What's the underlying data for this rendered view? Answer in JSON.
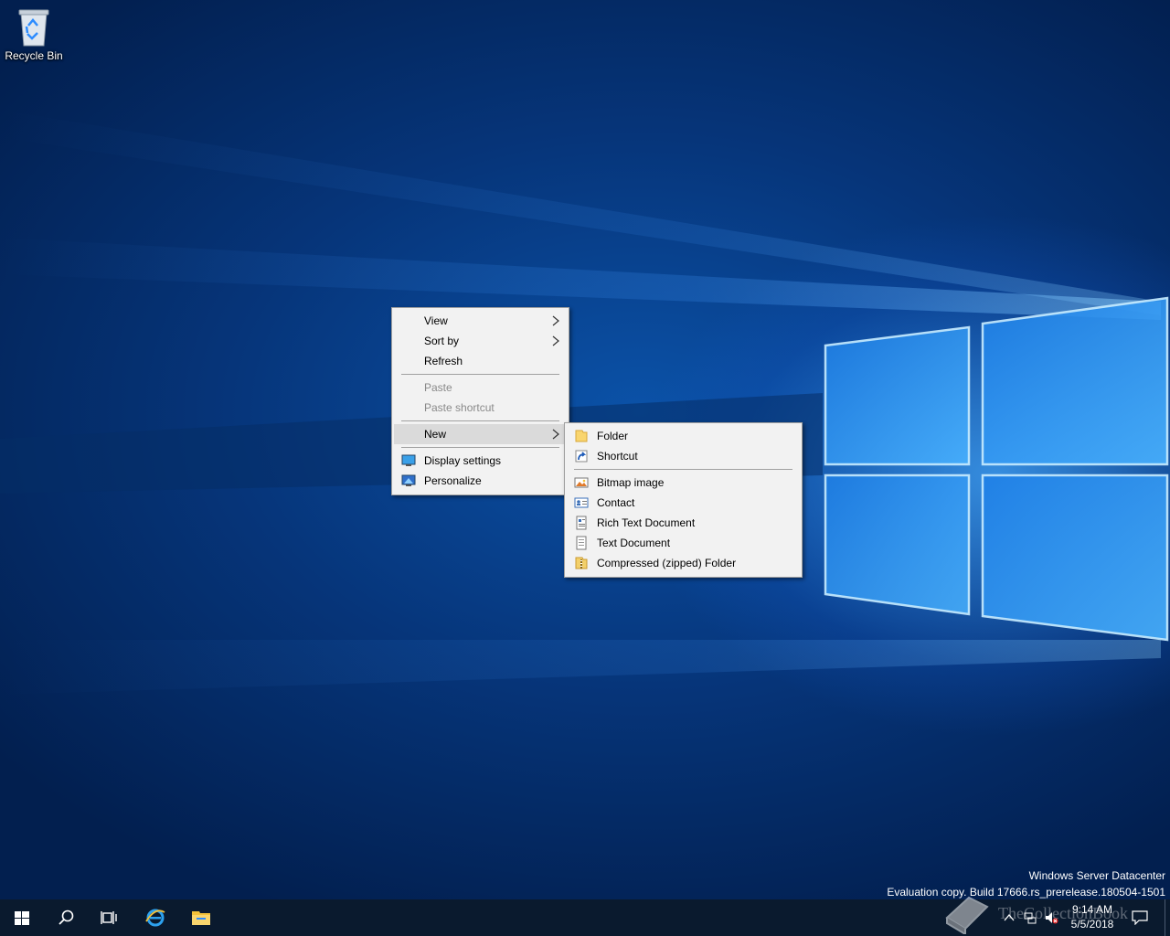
{
  "desktop": {
    "icons": [
      {
        "label": "Recycle Bin",
        "icon": "recycle-bin-icon"
      }
    ]
  },
  "context_menu": {
    "items": [
      {
        "label": "View",
        "has_submenu": true,
        "disabled": false
      },
      {
        "label": "Sort by",
        "has_submenu": true,
        "disabled": false
      },
      {
        "label": "Refresh",
        "has_submenu": false,
        "disabled": false
      },
      {
        "label": "Paste",
        "has_submenu": false,
        "disabled": true
      },
      {
        "label": "Paste shortcut",
        "has_submenu": false,
        "disabled": true
      },
      {
        "label": "New",
        "has_submenu": true,
        "disabled": false,
        "highlighted": true
      },
      {
        "label": "Display settings",
        "icon": "display-settings-icon"
      },
      {
        "label": "Personalize",
        "icon": "personalize-icon"
      }
    ]
  },
  "new_submenu": {
    "items": [
      {
        "label": "Folder",
        "icon": "folder-icon"
      },
      {
        "label": "Shortcut",
        "icon": "shortcut-icon"
      },
      {
        "label": "Bitmap image",
        "icon": "bitmap-image-icon"
      },
      {
        "label": "Contact",
        "icon": "contact-icon"
      },
      {
        "label": "Rich Text Document",
        "icon": "rich-text-document-icon"
      },
      {
        "label": "Text Document",
        "icon": "text-document-icon"
      },
      {
        "label": "Compressed (zipped) Folder",
        "icon": "zipped-folder-icon"
      }
    ]
  },
  "watermark": {
    "line1": "Windows Server Datacenter",
    "line2": "Evaluation copy. Build 17666.rs_prerelease.180504-1501"
  },
  "overlay": {
    "text": "TheCollectionBook"
  },
  "taskbar": {
    "buttons": [
      "start-icon",
      "search-icon",
      "task-view-icon",
      "internet-explorer-icon",
      "file-explorer-icon"
    ],
    "clock": {
      "time": "9:14 AM",
      "date": "5/5/2018"
    }
  },
  "colors": {
    "menu_bg": "#f2f2f2",
    "menu_highlight": "#dadada",
    "taskbar": "#0a1a2e"
  }
}
